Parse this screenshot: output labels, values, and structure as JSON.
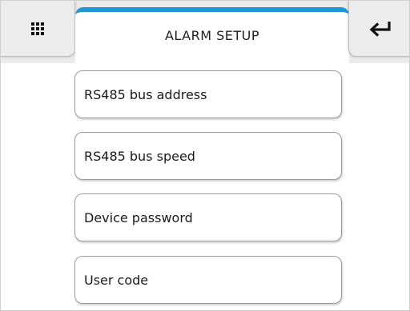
{
  "header": {
    "title": "ALARM SETUP",
    "menu_icon": "grid-icon",
    "back_icon": "return-arrow-icon",
    "accent_color": "#1f97d6"
  },
  "menu": {
    "items": [
      {
        "label": "RS485 bus address"
      },
      {
        "label": "RS485 bus speed"
      },
      {
        "label": "Device password"
      },
      {
        "label": "User code"
      }
    ]
  }
}
